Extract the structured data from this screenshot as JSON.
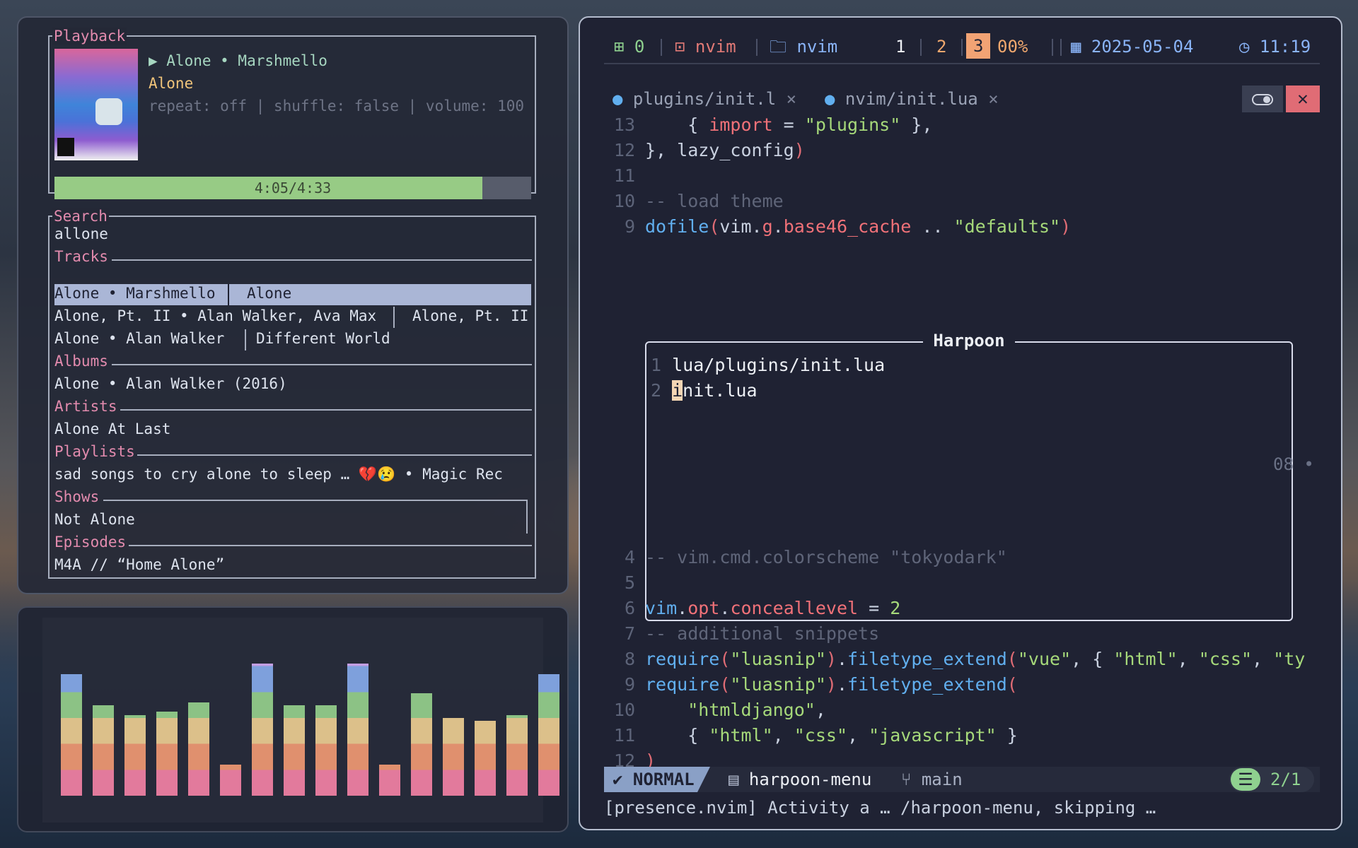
{
  "playback": {
    "pane_title": "Playback",
    "now_playing": "▶ Alone • Marshmello",
    "title": "Alone",
    "options": "repeat: off | shuffle: false | volume: 100",
    "progress_text": "4:05/4:33",
    "progress_fraction": 0.897
  },
  "search": {
    "pane_title": "Search",
    "query": "allone",
    "tracks_label": "Tracks",
    "tracks": [
      {
        "left": "Alone • Marshmello",
        "right": "Alone"
      },
      {
        "left": "Alone, Pt. II • Alan Walker, Ava Max",
        "right": "Alone, Pt. II"
      },
      {
        "left": "Alone • Alan Walker",
        "right": "Different World"
      }
    ],
    "albums_label": "Albums",
    "album": "Alone • Alan Walker (2016)",
    "artists_label": "Artists",
    "artist": "Alone At Last",
    "playlists_label": "Playlists",
    "playlist": "sad songs to cry alone to sleep …  💔😢 • Magic Rec",
    "shows_label": "Shows",
    "show": "Not Alone",
    "episodes_label": "Episodes",
    "episode": "M4A // “Home Alone”"
  },
  "visualizer": {
    "levels": [
      0.78,
      0.58,
      0.52,
      0.54,
      0.6,
      0.2,
      0.85,
      0.58,
      0.58,
      0.85,
      0.2,
      0.66,
      0.5,
      0.48,
      0.52,
      0.78
    ],
    "colors": [
      "#e27a9c",
      "#e0906e",
      "#dcc08a",
      "#8cc285",
      "#7ea0dc",
      "#c39ee2"
    ]
  },
  "topbar": {
    "workspace_count": "0",
    "app1": "nvim",
    "app2": "nvim",
    "ws1": "1",
    "ws2": "2",
    "ws3": "3",
    "battery": "00%",
    "date": "2025-05-04",
    "time": "11:19"
  },
  "tabs": {
    "tab1": "plugins/init.l",
    "tab2": "nvim/init.lua",
    "close": "×"
  },
  "code_top": [
    {
      "n": "13",
      "html": "    { <span class=\"pr\">import</span> = <span class=\"str\">\"plugins\"</span> },"
    },
    {
      "n": "12",
      "html": "}, lazy_config<span class=\"br\">)</span>"
    },
    {
      "n": "11",
      "html": ""
    },
    {
      "n": "10",
      "html": "<span class=\"cm\">-- load theme</span>"
    },
    {
      "n": "9",
      "html": "<span class=\"fn\">dofile</span><span class=\"br\">(</span>vim.<span class=\"pr\">g</span>.<span class=\"pr\">base46_cache</span> .. <span class=\"str\">\"defaults\"</span><span class=\"br\">)</span>"
    }
  ],
  "harpoon": {
    "title": "Harpoon",
    "items": [
      "lua/plugins/init.lua",
      "init.lua"
    ],
    "side_text": "08 •"
  },
  "code_bottom": [
    {
      "n": "4",
      "html": "<span class=\"cm\">-- vim.cmd.colorscheme \"tokyodark\"</span>"
    },
    {
      "n": "5",
      "html": ""
    },
    {
      "n": "6",
      "html": "<span class=\"fn\">vim</span>.<span class=\"pr\">opt</span>.<span class=\"pr\">conceallevel</span> = <span class=\"str\">2</span>"
    },
    {
      "n": "7",
      "html": "<span class=\"cm\">-- additional snippets</span>"
    },
    {
      "n": "8",
      "html": "<span class=\"fn\">require</span><span class=\"br\">(</span><span class=\"str\">\"luasnip\"</span><span class=\"br\">)</span>.<span class=\"fn\">filetype_extend</span><span class=\"br\">(</span><span class=\"str\">\"vue\"</span>, { <span class=\"str\">\"html\"</span>, <span class=\"str\">\"css\"</span>, <span class=\"str\">\"ty</span>"
    },
    {
      "n": "9",
      "html": "<span class=\"fn\">require</span><span class=\"br\">(</span><span class=\"str\">\"luasnip\"</span><span class=\"br\">)</span>.<span class=\"fn\">filetype_extend</span><span class=\"br\">(</span>"
    },
    {
      "n": "10",
      "html": "    <span class=\"str\">\"htmldjango\"</span>,"
    },
    {
      "n": "11",
      "html": "    { <span class=\"str\">\"html\"</span>, <span class=\"str\">\"css\"</span>, <span class=\"str\">\"javascript\"</span> }"
    },
    {
      "n": "12",
      "html": "<span class=\"br\">)</span>"
    }
  ],
  "statusline": {
    "mode": "NORMAL",
    "file": "harpoon-menu",
    "branch": "main",
    "position": "2/1"
  },
  "cmdline": "[presence.nvim] Activity a … /harpoon-menu, skipping …"
}
